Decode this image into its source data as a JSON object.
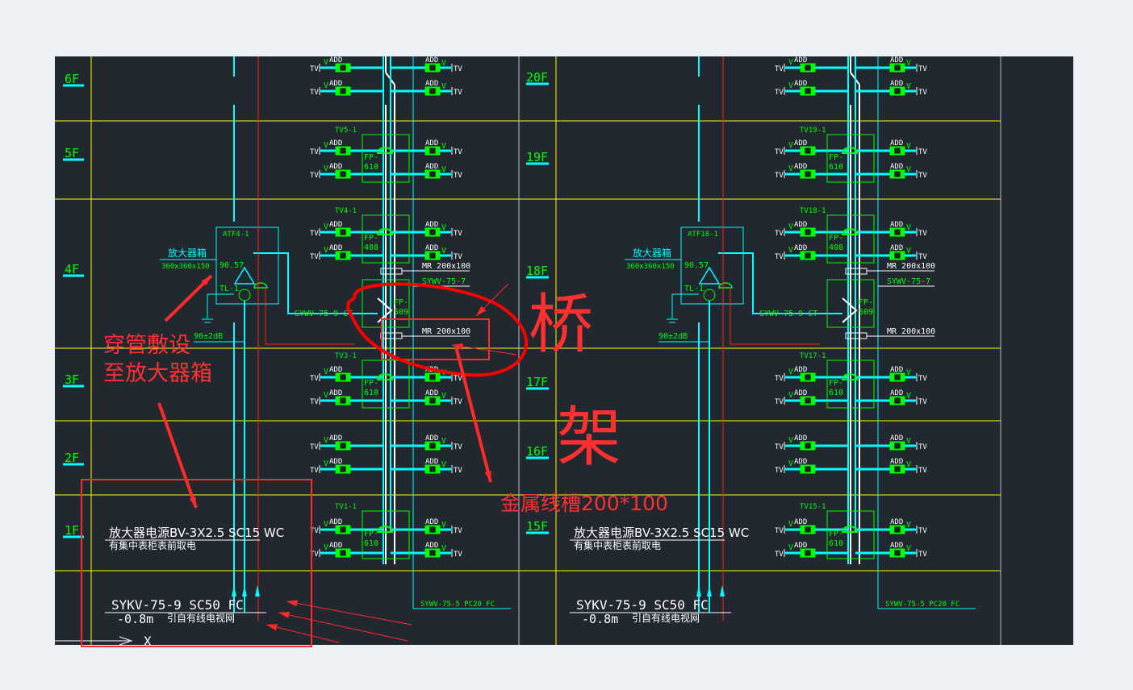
{
  "colors": {
    "background": "#212830",
    "outer": "#edf1f6",
    "grid": "#ffff00",
    "cable": "#00ffff",
    "label": "#00ff00",
    "riser": "#ffffff",
    "annotation": "#ff2a2a"
  },
  "floors_left": [
    "6F",
    "5F",
    "4F",
    "3F",
    "2F",
    "1F"
  ],
  "floors_right": [
    "20F",
    "19F",
    "18F",
    "17F",
    "16F",
    "15F"
  ],
  "outlet": {
    "add": "ADD",
    "v": "V",
    "tv": "TV"
  },
  "left_tower": {
    "tv_labels": {
      "5F": "TV5-1",
      "4F": "TV4-1",
      "3F": "TV3-1",
      "1F": "TV1-1"
    },
    "fp_labels": {
      "5F": "FP-610",
      "4F": "FP-408",
      "3F": "FP-610",
      "1F": "FP-610",
      "splitter": "FP-509"
    },
    "amp_box": {
      "id": "ATF4-1",
      "name": "放大器箱",
      "size": "360x360x150",
      "level": "90.57",
      "tl": "TL-1",
      "output": "90±2dB"
    },
    "tray_labels": [
      "MR 200x100",
      "SYWV-75-7",
      "MR 200x100"
    ],
    "feed_label": "SYWV-75-9 CT",
    "power_label": "放大器电源BV-3X2.5 SC15 WC",
    "power_note": "有集中表柜表前取电",
    "incoming_label": "SYKV-75-9 SC50 FC",
    "incoming_level": "-0.8m",
    "incoming_note": "引自有线电视网",
    "riser_label": "SYWV-75-5 PC20 FC",
    "axis_label": "X"
  },
  "right_tower": {
    "tv_labels": {
      "19F": "TV19-1",
      "18F": "TV18-1",
      "17F": "TV17-1",
      "15F": "TV15-1"
    },
    "fp_labels": {
      "19F": "FP-610",
      "18F": "FP-408",
      "17F": "FP-610",
      "15F": "FP-610",
      "splitter": "FP-509"
    },
    "amp_box": {
      "id": "ATF18-1",
      "name": "放大器箱",
      "size": "360x360x150",
      "level": "90.57",
      "tl": "TL-1",
      "output": "90±2dB"
    },
    "tray_labels": [
      "MR 200x100",
      "SYWV-75-7",
      "MR 200x100"
    ],
    "feed_label": "SYWV-75-9 CT",
    "power_label": "放大器电源BV-3X2.5 SC15 WC",
    "power_note": "有集中表柜表前取电",
    "incoming_label": "SYKV-75-9 SC50 FC",
    "incoming_level": "-0.8m",
    "incoming_note": "引自有线电视网",
    "riser_label": "SYWV-75-5 PC20 FC"
  },
  "annotations": {
    "conduit_line1": "穿管敷设",
    "conduit_line2": "至放大器箱",
    "tray": "桥架",
    "trunking": "金属线槽200*100"
  }
}
